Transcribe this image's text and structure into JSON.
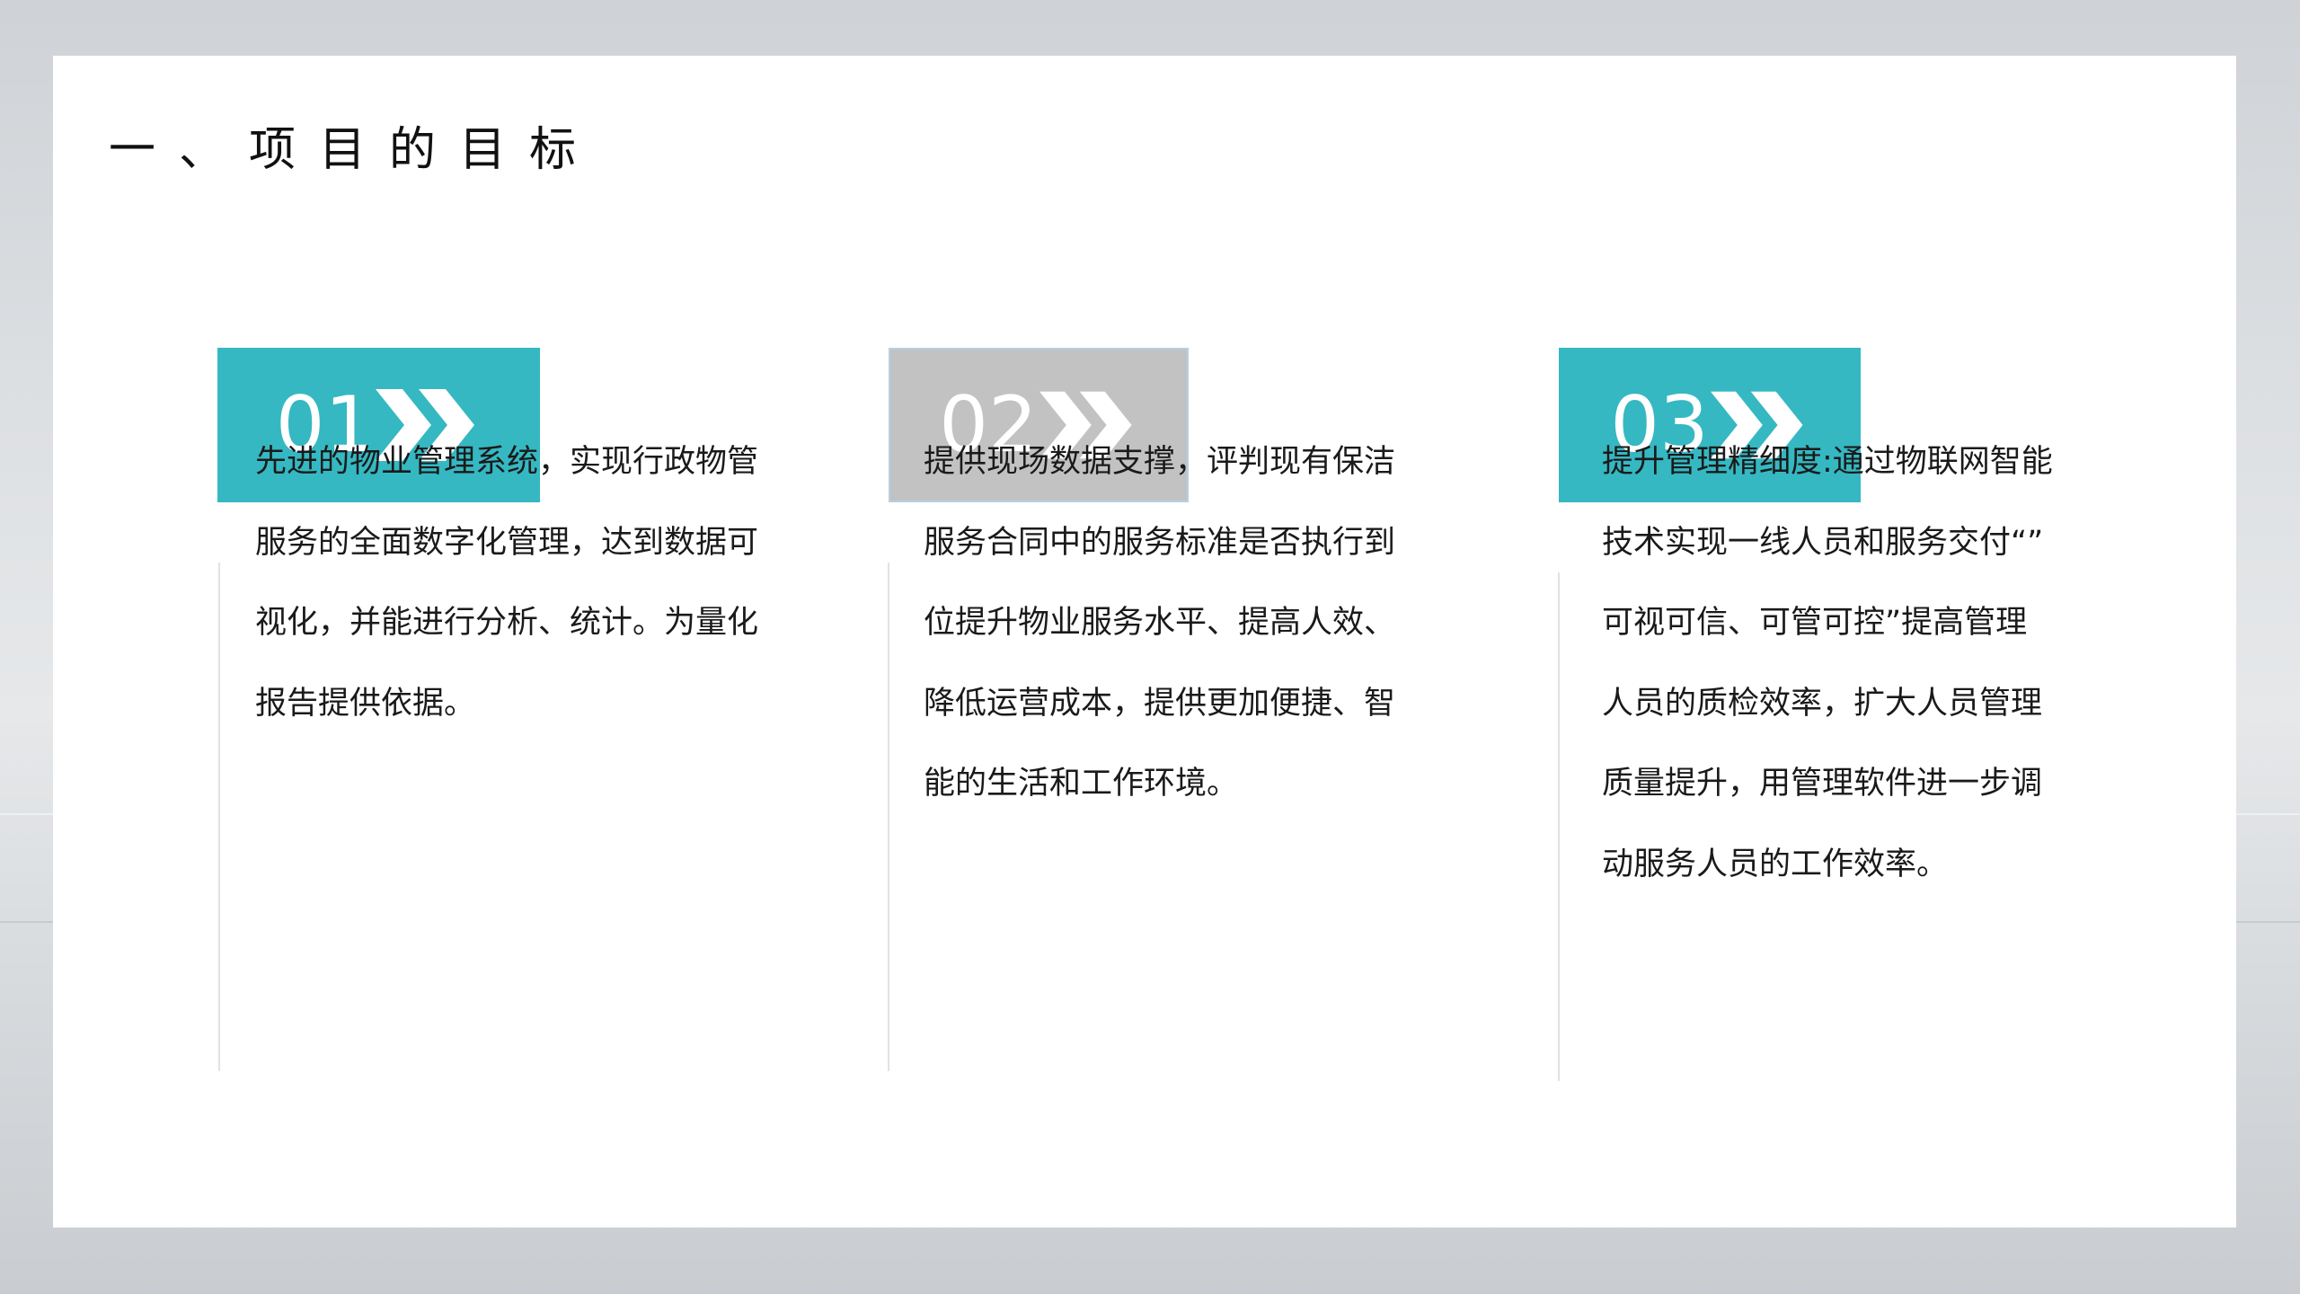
{
  "title": "一、项目的目标",
  "items": [
    {
      "number": "01",
      "lines": [
        "先进的物业管理系统，实现行政物管",
        "服务的全面数字化管理，达到数据可",
        "视化，并能进行分析、统计。为量化",
        "报告提供依据。"
      ]
    },
    {
      "number": "02",
      "lines": [
        "提供现场数据支撑，评判现有保洁",
        "服务合同中的服务标准是否执行到",
        "位提升物业服务水平、提高人效、",
        "降低运营成本，提供更加便捷、智",
        "能的生活和工作环境。"
      ]
    },
    {
      "number": "03",
      "lines": [
        "提升管理精细度:通过物联网智能",
        "技术实现一线人员和服务交付“”",
        "可视可信、可管可控”提高管理",
        "人员的质检效率，扩大人员管理",
        "质量提升，用管理软件进一步调",
        "动服务人员的工作效率。"
      ]
    }
  ],
  "colors": {
    "teal": "#35b8c2",
    "gray": "#c2c2c2"
  },
  "icons": {
    "badge_arrow": "double-chevron-right-icon"
  }
}
